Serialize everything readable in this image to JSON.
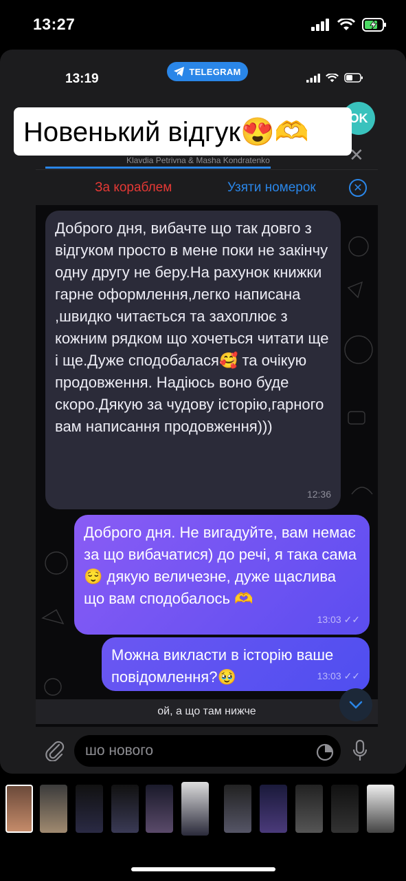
{
  "outer_status": {
    "time": "13:27"
  },
  "inner_status": {
    "time": "13:19",
    "app_pill": "TELEGRAM"
  },
  "sticker_text": "Новенький відгук😍🫶",
  "header": {
    "avatar_initials": "OK",
    "pinned_subtitle": "Klavdia Petrivna & Masha Kondratenko"
  },
  "actions": {
    "left": "За кораблем",
    "right": "Узяти номерок"
  },
  "messages": [
    {
      "direction": "in",
      "text": "Доброго дня, вибачте що так довго з відгуком просто в мене поки не закінчу одну другу не беру.На рахунок книжки гарне оформлення,легко написана ,швидко читається та захоплює з кожним рядком що хочеться читати ще і ще.Дуже сподобалася🥰 та очікую продовження. Надіюсь воно буде скоро.Дякую за чудову історію,гарного вам написання продовження)))",
      "time": "12:36"
    },
    {
      "direction": "out",
      "text": "Доброго дня. Не вигадуйте, вам немає за що вибачатися) до речі, я така сама😌 дякую величезне, дуже щаслива що вам сподобалось 🫶",
      "time": "13:03"
    },
    {
      "direction": "out",
      "text": "Можна викласти в історію ваше повідомлення?🥹",
      "time": "13:03"
    }
  ],
  "preview_text": "ой, а що там нижче",
  "input": {
    "placeholder": "шо нового"
  },
  "colors": {
    "accent": "#2a86e8",
    "danger": "#e53935",
    "outgoing_bubble": "#7a57f3",
    "incoming_bubble": "#2b2b39"
  },
  "icons": [
    "signal-icon",
    "wifi-icon",
    "battery-charging-icon",
    "telegram-icon",
    "close-icon",
    "close-circle-icon",
    "chevron-down-icon",
    "paperclip-icon",
    "sticker-icon",
    "microphone-icon"
  ]
}
